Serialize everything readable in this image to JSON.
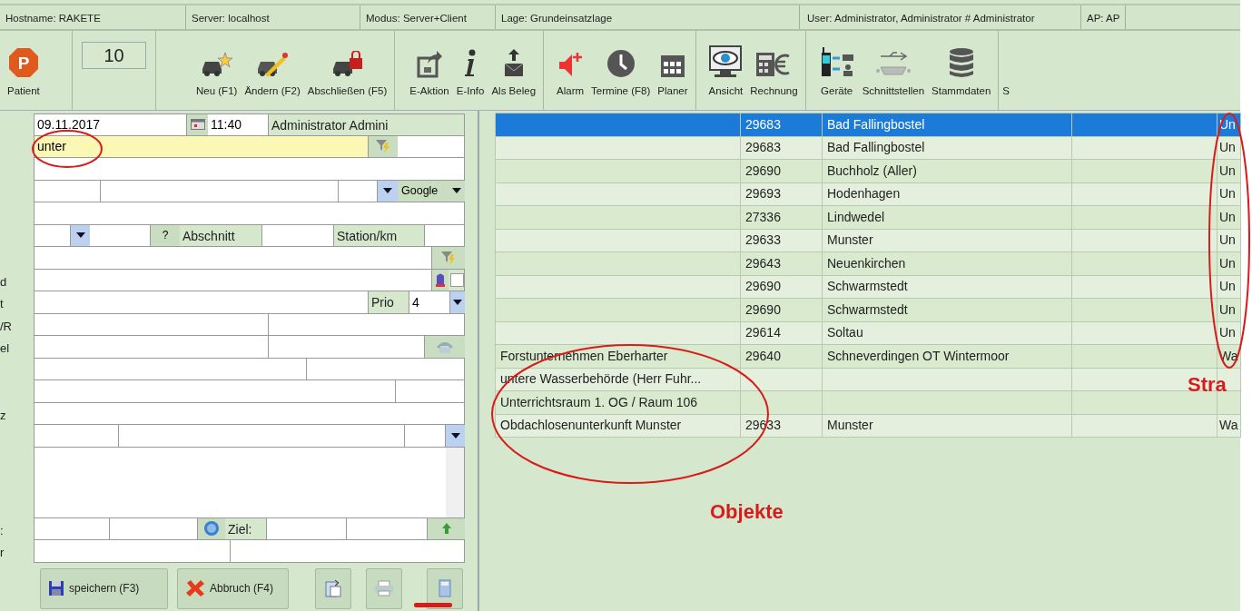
{
  "status_bar": [
    "Hostname: RAKETE",
    "Server: localhost",
    "Modus: Server+Client",
    "Lage: Grundeinsatzlage",
    "User: Administrator, Administrator # Administrator",
    "AP: AP"
  ],
  "toolbar": {
    "patient_letter": "P",
    "patient_label": "Patient",
    "counter": "10",
    "groups": [
      [
        "Neu (F1)",
        "Ändern (F2)",
        "Abschließen (F5)"
      ],
      [
        "E-Aktion",
        "E-Info",
        "Als Beleg"
      ],
      [
        "Alarm",
        "Termine (F8)",
        "Planer"
      ],
      [
        "Ansicht",
        "Rechnung"
      ],
      [
        "Geräte",
        "Schnittstellen",
        "Stammdaten"
      ],
      [
        "S"
      ]
    ]
  },
  "form": {
    "date": "09.11.2017",
    "time": "11:40",
    "user": "Administrator Admini",
    "search": "unter",
    "map_provider": "Google",
    "section_help": "?",
    "section_label": "Abschnitt",
    "station_label": "Station/km",
    "alarm_checked": false,
    "prio_label": "Prio",
    "prio": "4",
    "target_label": "Ziel:",
    "side_labels": [
      "d",
      "t",
      "/R",
      "el",
      "z",
      ":",
      "r"
    ]
  },
  "buttons": [
    "speichern (F3)",
    "Abbruch (F4)"
  ],
  "table": {
    "rows": [
      {
        "selected": true,
        "postcode": "29683",
        "town": "Bad Fallingbostel",
        "column_5": "Un"
      },
      {
        "selected": false,
        "postcode": "29683",
        "town": "Bad Fallingbostel",
        "column_5": "Un"
      },
      {
        "selected": false,
        "postcode": "29690",
        "town": "Buchholz (Aller)",
        "column_5": "Un"
      },
      {
        "selected": false,
        "postcode": "29693",
        "town": "Hodenhagen",
        "column_5": "Un"
      },
      {
        "selected": false,
        "postcode": "27336",
        "town": "Lindwedel",
        "column_5": "Un"
      },
      {
        "selected": false,
        "postcode": "29633",
        "town": "Munster",
        "column_5": "Un"
      },
      {
        "selected": false,
        "postcode": "29643",
        "town": "Neuenkirchen",
        "column_5": "Un"
      },
      {
        "selected": false,
        "postcode": "29690",
        "town": "Schwarmstedt",
        "column_5": "Un"
      },
      {
        "selected": false,
        "postcode": "29690",
        "town": "Schwarmstedt",
        "column_5": "Un"
      },
      {
        "selected": false,
        "postcode": "29614",
        "town": "Soltau",
        "column_5": "Un"
      },
      {
        "selected": false,
        "object": "Forstunternehmen Eberharter",
        "postcode": "29640",
        "town": "Schneverdingen OT Wintermoor",
        "column_5": "Wa"
      },
      {
        "selected": false,
        "object": "untere Wasserbehörde (Herr Fuhr..."
      },
      {
        "selected": false,
        "object": "Unterrichtsraum 1. OG / Raum 106"
      },
      {
        "selected": false,
        "object": "Obdachlosenunterkunft Munster",
        "postcode": "29633",
        "town": "Munster",
        "column_5": "Wa"
      }
    ]
  },
  "annotations": [
    "Objekte",
    "Stra"
  ]
}
